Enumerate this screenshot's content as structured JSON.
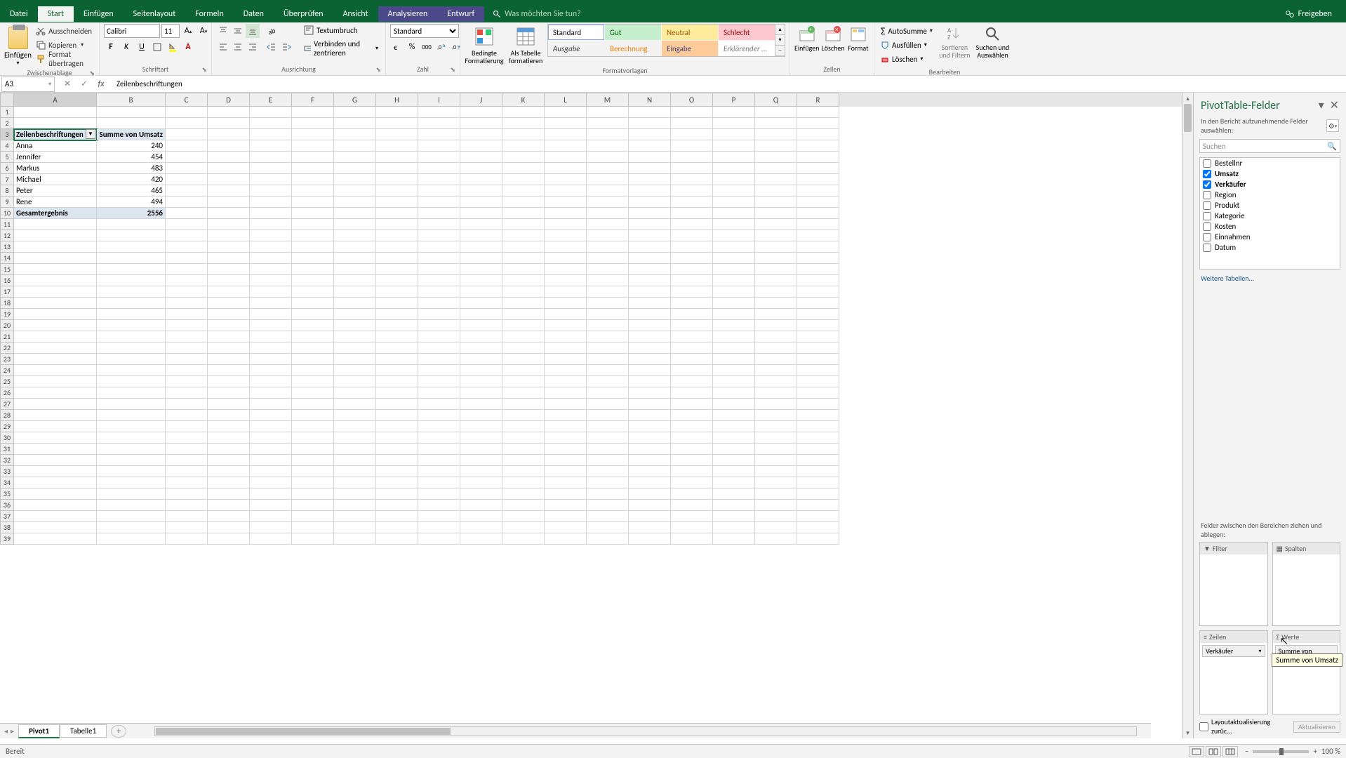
{
  "menubar": {
    "tabs": [
      "Datei",
      "Start",
      "Einfügen",
      "Seitenlayout",
      "Formeln",
      "Daten",
      "Überprüfen",
      "Ansicht",
      "Analysieren",
      "Entwurf"
    ],
    "active": "Start",
    "search_placeholder": "Was möchten Sie tun?",
    "share": "Freigeben"
  },
  "ribbon": {
    "clipboard": {
      "label": "Zwischenablage",
      "paste": "Einfügen",
      "cut": "Ausschneiden",
      "copy": "Kopieren",
      "painter": "Format übertragen"
    },
    "font": {
      "label": "Schriftart",
      "name": "Calibri",
      "size": "11"
    },
    "align": {
      "label": "Ausrichtung",
      "wrap": "Textumbruch",
      "merge": "Verbinden und zentrieren"
    },
    "number": {
      "label": "Zahl",
      "format": "Standard"
    },
    "styles": {
      "label": "Formatvorlagen",
      "cond": "Bedingte Formatierung",
      "table": "Als Tabelle formatieren",
      "gallery": [
        "Standard",
        "Gut",
        "Neutral",
        "Schlecht",
        "Ausgabe",
        "Berechnung",
        "Eingabe",
        "Erklärender ..."
      ]
    },
    "cells": {
      "label": "Zellen",
      "insert": "Einfügen",
      "delete": "Löschen",
      "format": "Format"
    },
    "editing": {
      "label": "Bearbeiten",
      "sum": "AutoSumme",
      "fill": "Ausfüllen",
      "clear": "Löschen",
      "sort": "Sortieren und Filtern",
      "find": "Suchen und Auswählen"
    }
  },
  "formulabar": {
    "cell": "A3",
    "value": "Zeilenbeschriftungen"
  },
  "columns": [
    "A",
    "B",
    "C",
    "D",
    "E",
    "F",
    "G",
    "H",
    "I",
    "J",
    "K",
    "L",
    "M",
    "N",
    "O",
    "P",
    "Q",
    "R"
  ],
  "pivot_table": {
    "row_header": "Zeilenbeschriftungen",
    "val_header": "Summe von Umsatz",
    "rows": [
      {
        "label": "Anna",
        "val": "240"
      },
      {
        "label": "Jennifer",
        "val": "454"
      },
      {
        "label": "Markus",
        "val": "483"
      },
      {
        "label": "Michael",
        "val": "420"
      },
      {
        "label": "Peter",
        "val": "465"
      },
      {
        "label": "Rene",
        "val": "494"
      }
    ],
    "total_label": "Gesamtergebnis",
    "total_val": "2556"
  },
  "sheets": {
    "active": "Pivot1",
    "others": [
      "Tabelle1"
    ]
  },
  "pivotpane": {
    "title": "PivotTable-Felder",
    "subtitle": "In den Bericht aufzunehmende Felder auswählen:",
    "search": "Suchen",
    "fields": [
      {
        "name": "Bestellnr",
        "checked": false
      },
      {
        "name": "Umsatz",
        "checked": true
      },
      {
        "name": "Verkäufer",
        "checked": true
      },
      {
        "name": "Region",
        "checked": false
      },
      {
        "name": "Produkt",
        "checked": false
      },
      {
        "name": "Kategorie",
        "checked": false
      },
      {
        "name": "Kosten",
        "checked": false
      },
      {
        "name": "Einnahmen",
        "checked": false
      },
      {
        "name": "Datum",
        "checked": false
      }
    ],
    "more": "Weitere Tabellen...",
    "areas_label": "Felder zwischen den Bereichen ziehen und ablegen:",
    "filter": "Filter",
    "columns": "Spalten",
    "rowsA": "Zeilen",
    "values": "Werte",
    "rows_item": "Verkäufer",
    "values_item": "Summe von Ums...",
    "tooltip": "Summe von Umsatz",
    "defer": "Layoutaktualisierung zurüc...",
    "update": "Aktualisieren"
  },
  "statusbar": {
    "ready": "Bereit",
    "zoom": "100 %"
  }
}
